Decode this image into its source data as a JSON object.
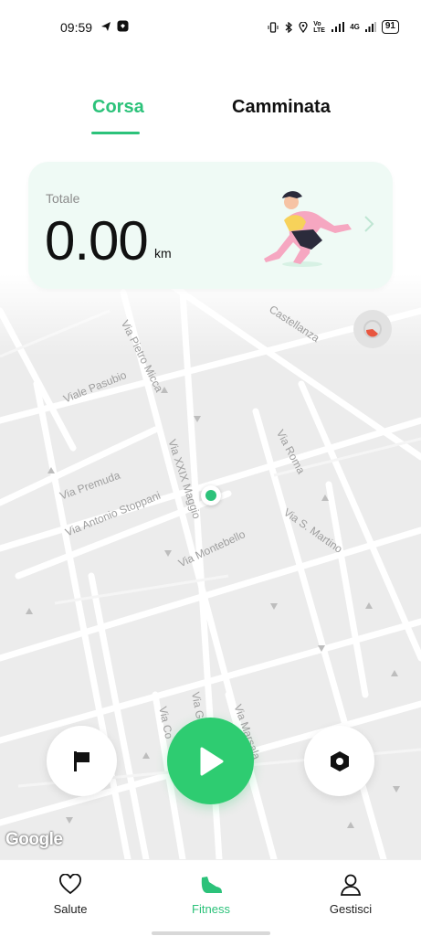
{
  "status_bar": {
    "time": "09:59",
    "network_label": "Vo LTE",
    "signal_label": "4G",
    "battery": "91"
  },
  "tabs": [
    {
      "label": "Corsa",
      "active": true
    },
    {
      "label": "Camminata",
      "active": false
    }
  ],
  "summary": {
    "label": "Totale",
    "value": "0.00",
    "unit": "km"
  },
  "map": {
    "streets": [
      "Via Pietro Micca",
      "Castellanza",
      "Viale Pasubio",
      "Via Roma",
      "Via XXIX Maggio",
      "Via Premuda",
      "Via Antonio Stoppani",
      "Via S. Martino",
      "Via Montebello",
      "Via Gi",
      "Via Co",
      "Via Marsala"
    ],
    "attribution": "Google"
  },
  "actions": {
    "flag_icon": "flag-icon",
    "start_icon": "play-icon",
    "settings_icon": "hexagon-settings-icon"
  },
  "bottom_nav": [
    {
      "label": "Salute",
      "icon": "heart-icon",
      "active": false
    },
    {
      "label": "Fitness",
      "icon": "shoe-icon",
      "active": true
    },
    {
      "label": "Gestisci",
      "icon": "person-icon",
      "active": false
    }
  ],
  "colors": {
    "accent": "#2cc27a",
    "card_bg": "#effaf5",
    "map_bg": "#ececec"
  }
}
